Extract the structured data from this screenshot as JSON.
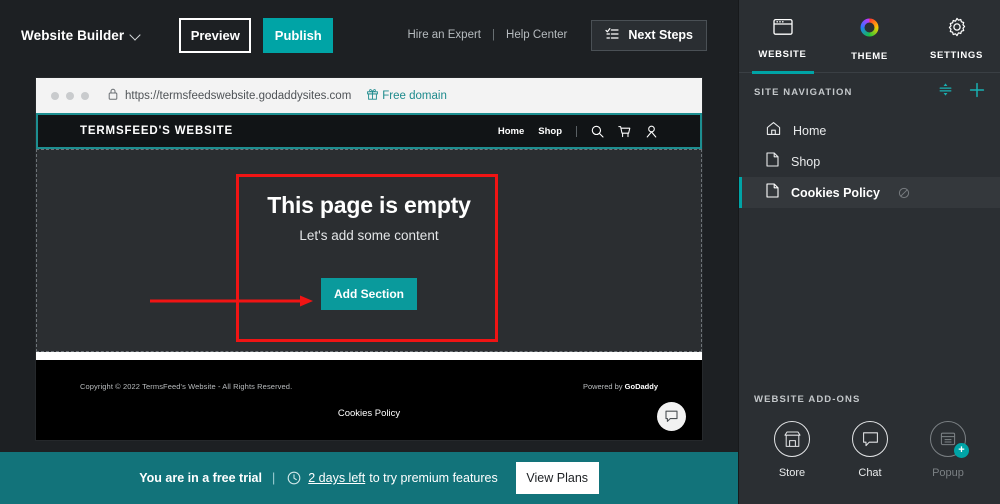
{
  "topbar": {
    "brand": "Website Builder",
    "brand_caret_icon": "chevron-down-icon",
    "preview_label": "Preview",
    "publish_label": "Publish",
    "hire_expert_label": "Hire an Expert",
    "separator": "|",
    "help_center_label": "Help Center",
    "next_steps_label": "Next Steps",
    "next_steps_icon": "checklist-icon"
  },
  "browser": {
    "lock_icon": "lock-icon",
    "url": "https://termsfeedswebsite.godaddysites.com",
    "free_domain_label": "Free domain",
    "gift_icon": "gift-icon"
  },
  "site": {
    "logo": "TERMSFEED'S WEBSITE",
    "nav": [
      {
        "label": "Home"
      },
      {
        "label": "Shop"
      }
    ],
    "nav_icons": [
      "search-icon",
      "cart-icon",
      "account-icon"
    ],
    "empty_title": "This page is empty",
    "empty_subtitle": "Let's add some content",
    "add_section_label": "Add Section",
    "footer": {
      "copyright": "Copyright © 2022 TermsFeed's Website - All Rights Reserved.",
      "powered_prefix": "Powered by ",
      "powered_brand": "GoDaddy",
      "cookies_policy_label": "Cookies Policy",
      "chat_icon": "chat-bubble-icon"
    }
  },
  "annotation": {
    "box_color": "#f01414",
    "arrow_color": "#f01414"
  },
  "trial": {
    "headline": "You are in a free trial",
    "separator": "|",
    "clock_icon": "clock-icon",
    "days_left": "2 days left",
    "rest": "to try premium features",
    "view_plans_label": "View Plans"
  },
  "panel": {
    "tabs": [
      {
        "label": "WEBSITE",
        "icon": "browser-window-icon",
        "active": true
      },
      {
        "label": "THEME",
        "icon": "color-wheel-icon",
        "active": false
      },
      {
        "label": "SETTINGS",
        "icon": "gear-icon",
        "active": false
      }
    ],
    "site_navigation": {
      "title": "SITE NAVIGATION",
      "reorder_icon": "reorder-icon",
      "add_icon": "plus-icon",
      "items": [
        {
          "label": "Home",
          "icon": "home-icon",
          "selected": false,
          "hidden": false
        },
        {
          "label": "Shop",
          "icon": "page-icon",
          "selected": false,
          "hidden": false
        },
        {
          "label": "Cookies Policy",
          "icon": "page-icon",
          "selected": true,
          "hidden": true,
          "hidden_icon": "eye-slash-icon"
        }
      ]
    },
    "addons": {
      "title": "WEBSITE ADD-ONS",
      "items": [
        {
          "label": "Store",
          "icon": "store-icon",
          "dim": false,
          "badge": ""
        },
        {
          "label": "Chat",
          "icon": "chat-icon",
          "dim": false,
          "badge": ""
        },
        {
          "label": "Popup",
          "icon": "popup-icon",
          "dim": true,
          "badge": "+"
        }
      ]
    }
  },
  "colors": {
    "accent_teal": "#00a4a6",
    "banner_teal": "#12737a",
    "annotation_red": "#f01414",
    "panel_bg": "#2b2f33",
    "app_bg": "#1d2023"
  }
}
